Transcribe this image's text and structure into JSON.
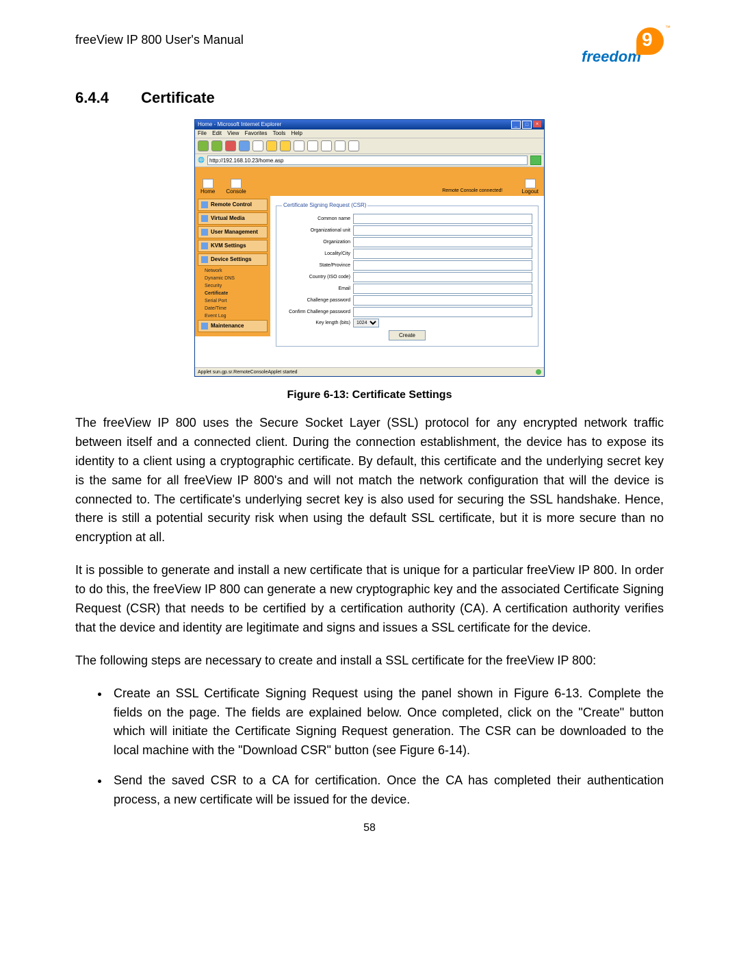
{
  "doc": {
    "header": "freeView IP 800 User's Manual",
    "logo_text": "freedom",
    "section_num": "6.4.4",
    "section_title": "Certificate",
    "figure_caption": "Figure 6-13: Certificate Settings",
    "page_number": "58"
  },
  "paragraphs": {
    "p1": "The freeView IP 800 uses the Secure Socket Layer (SSL) protocol for any encrypted network traffic between itself and a connected client. During the connection establishment, the device has to expose its identity to a client using a cryptographic certificate. By default, this certificate and the underlying secret key is the same for all freeView IP 800's and will not match the network configuration that will the device is connected to. The certificate's underlying secret key is also used for securing the SSL handshake. Hence, there is still a potential security risk when using the default SSL certificate, but it is more secure than no encryption at all.",
    "p2": "It is possible to generate and install a new certificate that is unique for a particular freeView IP 800. In order to do this, the freeView IP 800 can generate a new cryptographic key and the associated Certificate Signing Request (CSR) that needs to be certified by a certification authority (CA). A certification authority verifies that the device and identity are legitimate and signs and issues a SSL certificate for the device.",
    "p3": "The following steps are necessary to create and install a SSL certificate for the freeView IP 800:",
    "b1": "Create an SSL Certificate Signing Request using the panel shown in Figure 6-13. Complete the fields on the page. The fields are explained below. Once completed, click on the \"Create\" button which will initiate the Certificate Signing Request generation. The CSR can be downloaded to the local machine with the \"Download CSR\" button (see Figure 6-14).",
    "b2": "Send the saved CSR to a CA for certification. Once the CA has completed their authentication process, a new certificate will be issued for the device."
  },
  "shot": {
    "window_title": "Home - Microsoft Internet Explorer",
    "menus": {
      "file": "File",
      "edit": "Edit",
      "view": "View",
      "favorites": "Favorites",
      "tools": "Tools",
      "help": "Help"
    },
    "address": "http://192.168.10.23/home.asp",
    "topnav": {
      "home": "Home",
      "console": "Console",
      "logout": "Logout",
      "remote_status": "Remote Console connected!"
    },
    "sidebar": {
      "remote_control": "Remote Control",
      "virtual_media": "Virtual Media",
      "user_management": "User Management",
      "kvm_settings": "KVM Settings",
      "device_settings": "Device Settings",
      "sub": {
        "network": "Network",
        "dyndns": "Dynamic DNS",
        "security": "Security",
        "certificate": "Certificate",
        "serial": "Serial Port",
        "datetime": "Date/Time",
        "eventlog": "Event Log"
      },
      "maintenance": "Maintenance"
    },
    "form": {
      "legend": "Certificate Signing Request (CSR)",
      "common_name": "Common name",
      "org_unit": "Organizational unit",
      "organization": "Organization",
      "locality": "Locality/City",
      "state": "State/Province",
      "country": "Country (ISO code)",
      "email": "Email",
      "ch_pass": "Challenge password",
      "ch_pass2": "Confirm Challenge password",
      "key_length": "Key length (bits)",
      "key_length_value": "1024",
      "create_btn": "Create"
    },
    "status": "Applet sun.gp.sr.RemoteConsoleApplet started"
  }
}
